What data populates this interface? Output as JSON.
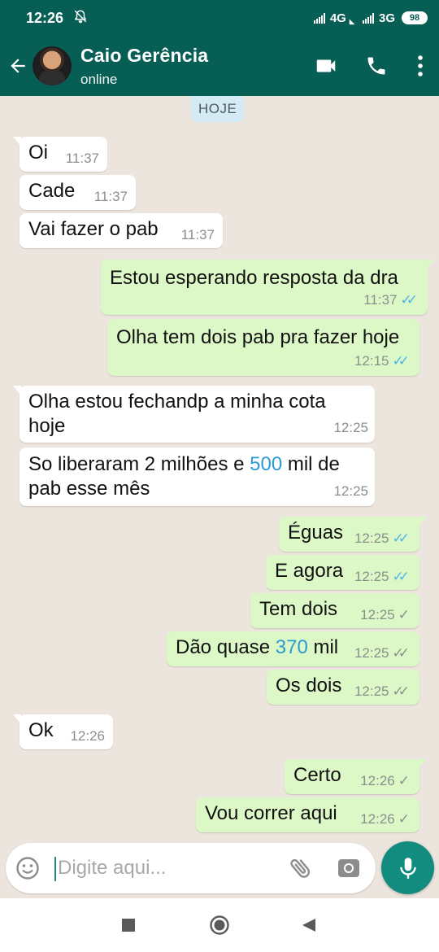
{
  "status_bar": {
    "time": "12:26",
    "network_1": "4G",
    "network_2": "3G",
    "battery": "98",
    "icons": [
      "mute-notification-icon",
      "signal-icon",
      "signal-icon",
      "battery-icon"
    ]
  },
  "header": {
    "contact_name": "Caio Gerência",
    "presence": "online",
    "icons": [
      "back-arrow-icon",
      "avatar",
      "video-call-icon",
      "voice-call-icon",
      "more-vert-icon"
    ]
  },
  "chat": {
    "day_label": "HOJE",
    "messages": [
      {
        "dir": "in",
        "text": "Oi",
        "time": "11:37"
      },
      {
        "dir": "in",
        "text": "Cade",
        "time": "11:37"
      },
      {
        "dir": "in",
        "text": "Vai fazer o pab",
        "time": "11:37"
      },
      {
        "dir": "out",
        "text": "Estou esperando resposta da dra",
        "time": "11:37",
        "status": "read"
      },
      {
        "dir": "out",
        "text": "Olha tem dois pab pra fazer hoje",
        "time": "12:15",
        "status": "read"
      },
      {
        "dir": "in",
        "text_line1": "Olha estou fechandp a minha cota",
        "text_line2": "hoje",
        "time": "12:25"
      },
      {
        "dir": "in",
        "text_pre": "So liberaram 2 milhões e ",
        "text_num": "500",
        "text_post": " mil de",
        "text_line2": "pab esse mês",
        "time": "12:25"
      },
      {
        "dir": "out",
        "text": "Éguas",
        "time": "12:25",
        "status": "read"
      },
      {
        "dir": "out",
        "text": "E agora",
        "time": "12:25",
        "status": "read"
      },
      {
        "dir": "out",
        "text": "Tem dois",
        "time": "12:25",
        "status": "sent"
      },
      {
        "dir": "out",
        "text_pre": "Dão quase ",
        "text_num": "370",
        "text_post": " mil",
        "time": "12:25",
        "status": "delivered"
      },
      {
        "dir": "out",
        "text": "Os dois",
        "time": "12:25",
        "status": "delivered"
      },
      {
        "dir": "in",
        "text": "Ok",
        "time": "12:26"
      },
      {
        "dir": "out",
        "text": "Certo",
        "time": "12:26",
        "status": "sent"
      },
      {
        "dir": "out",
        "text": "Vou correr aqui",
        "time": "12:26",
        "status": "sent"
      }
    ]
  },
  "composer": {
    "placeholder": "Digite aqui...",
    "icons": [
      "emoji-icon",
      "attach-icon",
      "camera-icon",
      "mic-icon"
    ]
  },
  "navbar": {
    "icons": [
      "recents-icon",
      "home-icon",
      "back-icon"
    ]
  },
  "colors": {
    "header": "#075e54",
    "chat_bg": "#ece5dd",
    "outgoing_bubble": "#dcf8c6",
    "incoming_bubble": "#ffffff",
    "read_tick": "#4fb6ec",
    "mic_button": "#128c7e",
    "number_highlight": "#2b9ad4"
  }
}
